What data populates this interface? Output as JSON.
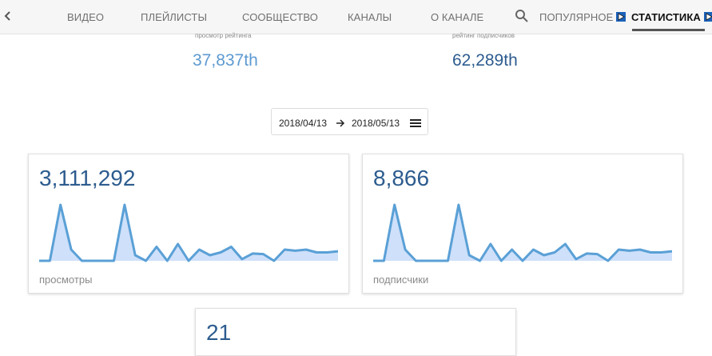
{
  "tabs": [
    {
      "label": "ВИДЕО"
    },
    {
      "label": "ПЛЕЙЛИСТЫ"
    },
    {
      "label": "СООБЩЕСТВО"
    },
    {
      "label": "КАНАЛЫ"
    },
    {
      "label": "О КАНАЛЕ"
    },
    {
      "label": "ПОПУЛЯРНОЕ"
    },
    {
      "label": "СТАТИСТИКА"
    }
  ],
  "ranks": {
    "views_caption": "просмотр рейтинга",
    "views_value": "37,837th",
    "subs_caption": "рейтинг подписчиков",
    "subs_value": "62,289th"
  },
  "date_range": {
    "start": "2018/04/13",
    "end": "2018/05/13"
  },
  "cards": [
    {
      "value": "3,111,292",
      "label": "просмотры"
    },
    {
      "value": "8,866",
      "label": "подписчики"
    },
    {
      "value": "21"
    }
  ],
  "colors": {
    "accent": "#2d5c8f",
    "accent_light": "#5d9ad1",
    "sparkline_stroke": "#5aa0d6",
    "sparkline_fill": "#cfe0fa",
    "badge": "#1c62b9"
  },
  "chart_data": [
    {
      "type": "area",
      "values": [
        0,
        0,
        10,
        2,
        0,
        0,
        0,
        0,
        10,
        1,
        0,
        2.5,
        0,
        3,
        0,
        2,
        1,
        1.5,
        2.5,
        0.3,
        1.3,
        1.2,
        0,
        2,
        1.8,
        2,
        1.5,
        1.5,
        1.7
      ]
    },
    {
      "type": "area",
      "values": [
        0,
        0,
        10,
        2,
        0,
        0,
        0,
        0,
        10,
        1,
        0,
        3,
        0,
        2,
        0,
        2,
        1,
        1.5,
        3,
        0.3,
        1.3,
        1.2,
        0,
        2,
        1.8,
        2,
        1.5,
        1.5,
        1.7
      ]
    }
  ]
}
